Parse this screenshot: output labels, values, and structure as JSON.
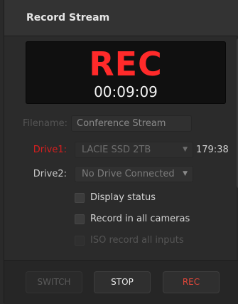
{
  "panel": {
    "title": "Record Stream"
  },
  "display": {
    "rec_label": "REC",
    "timecode": "00:09:09"
  },
  "filename": {
    "label": "Filename:",
    "value": "Conference Stream"
  },
  "drive1": {
    "label": "Drive1:",
    "value": "LACIE SSD 2TB",
    "remaining": "179:38"
  },
  "drive2": {
    "label": "Drive2:",
    "value": "No Drive Connected"
  },
  "options": {
    "display_status": "Display status",
    "record_all_cameras": "Record in all cameras",
    "iso_record_all_inputs": "ISO record all inputs"
  },
  "buttons": {
    "switch": "SWITCH",
    "stop": "STOP",
    "rec": "REC"
  },
  "colors": {
    "rec_red": "#ff2a2a",
    "drive1_label_red": "#d61f1f",
    "rec_button_text": "#e0473a",
    "text_light": "#d8d8d8",
    "text_disabled": "#555555"
  }
}
